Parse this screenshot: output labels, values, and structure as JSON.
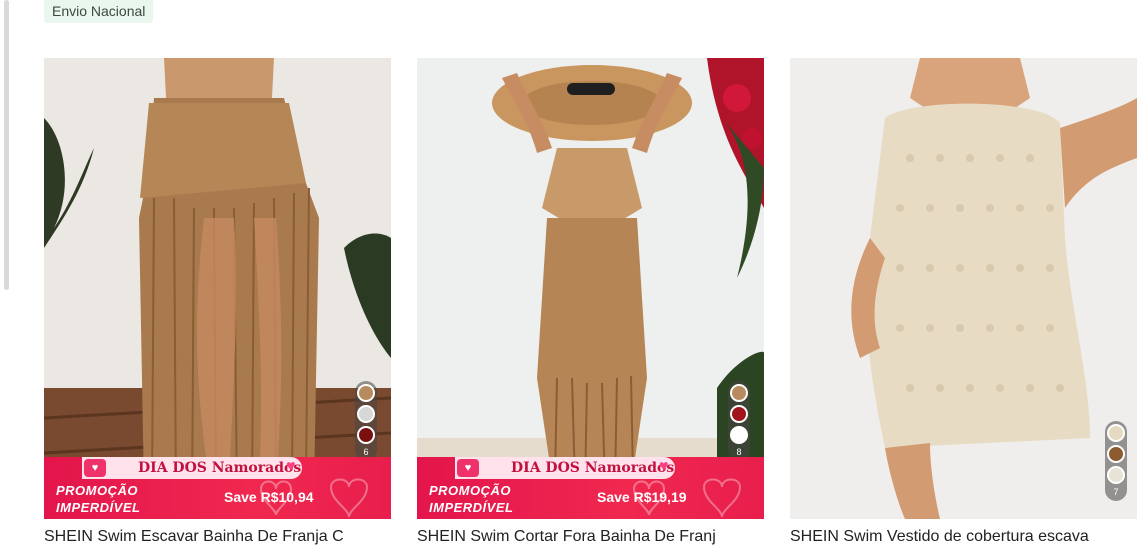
{
  "tag": {
    "label": "Envio Nacional"
  },
  "products": [
    {
      "title": "SHEIN Swim Escavar Bainha De Franja C",
      "promo": {
        "banner": "DIA DOS Namorados",
        "line1": "PROMOÇÃO",
        "line2": "IMPERDÍVEL",
        "save": "Save R$10,94"
      },
      "swatches": [
        "#b88b5e",
        "#d7d7d7",
        "#7a0f0f"
      ],
      "swatch_count": "6"
    },
    {
      "title": "SHEIN Swim Cortar Fora Bainha De Franj",
      "promo": {
        "banner": "DIA DOS Namorados",
        "line1": "PROMOÇÃO",
        "line2": "IMPERDÍVEL",
        "save": "Save R$19,19"
      },
      "swatches": [
        "#b88b5e",
        "#a1141e",
        "#ffffff"
      ],
      "swatch_count": "8"
    },
    {
      "title": "SHEIN Swim Vestido de cobertura escava",
      "swatches": [
        "#e6d9c1",
        "#8c5b30",
        "#e9e3d6"
      ],
      "swatch_count": "7"
    }
  ]
}
